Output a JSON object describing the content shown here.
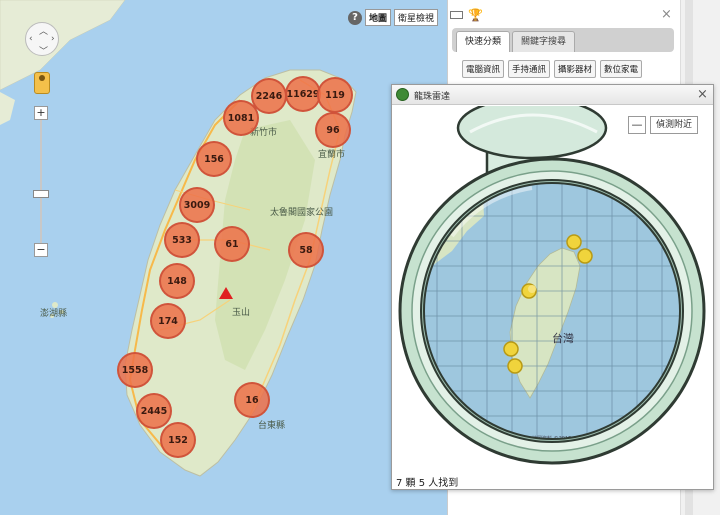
{
  "map": {
    "type_buttons": {
      "map": "地圖",
      "satellite": "衛星檢視"
    },
    "help_glyph": "?",
    "labels": {
      "park": "太魯閣國家公園",
      "jade": "玉山",
      "penghu": "澎湖縣",
      "hsinchu": "新竹市",
      "yilan": "宜蘭市",
      "taitung": "台東縣"
    },
    "clusters": [
      {
        "id": "c-2246",
        "label": "2246"
      },
      {
        "id": "c-11629",
        "label": "11629"
      },
      {
        "id": "c-119",
        "label": "119"
      },
      {
        "id": "c-1081",
        "label": "1081"
      },
      {
        "id": "c-96",
        "label": "96"
      },
      {
        "id": "c-156",
        "label": "156"
      },
      {
        "id": "c-3009",
        "label": "3009"
      },
      {
        "id": "c-533",
        "label": "533"
      },
      {
        "id": "c-61",
        "label": "61"
      },
      {
        "id": "c-58",
        "label": "58"
      },
      {
        "id": "c-148",
        "label": "148"
      },
      {
        "id": "c-174",
        "label": "174"
      },
      {
        "id": "c-1558",
        "label": "1558"
      },
      {
        "id": "c-2445",
        "label": "2445"
      },
      {
        "id": "c-16",
        "label": "16"
      },
      {
        "id": "c-152",
        "label": "152"
      }
    ],
    "zoom_in": "+",
    "zoom_out": "−"
  },
  "panel": {
    "close_glyph": "×",
    "tabs": [
      {
        "label": "快速分類",
        "active": true
      },
      {
        "label": "關鍵字搜尋",
        "active": false
      }
    ],
    "categories": [
      "電腦資訊",
      "手持通訊",
      "攝影器材",
      "數位家電"
    ]
  },
  "radar": {
    "title": "龍珠雷達",
    "close_glyph": "×",
    "minus_label": "—",
    "detect_label": "偵測附近",
    "map_label": "台灣",
    "credit": "地圖資料 ©2015 Google",
    "status": "7 顆 5 人找到"
  },
  "colors": {
    "sea": "#a9d0ee",
    "land": "#dfe9c9",
    "cluster": "#ed7048",
    "radar_frame": "#c6e2cf",
    "dragonball": "#f0d43c"
  }
}
